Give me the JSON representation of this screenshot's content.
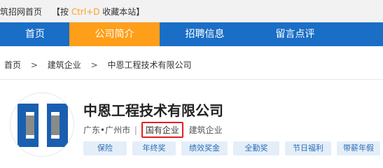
{
  "topbar": {
    "site_link": "筑招网首页",
    "bookmark_prefix": "【按 ",
    "bookmark_key": "Ctrl+D",
    "bookmark_suffix": " 收藏本站】"
  },
  "nav": {
    "items": [
      {
        "label": "首页",
        "active": false
      },
      {
        "label": "公司简介",
        "active": true
      },
      {
        "label": "招聘信息",
        "active": false
      },
      {
        "label": "留言点评",
        "active": false
      }
    ]
  },
  "breadcrumb": {
    "items": [
      "首页",
      "建筑企业",
      "中恩工程技术有限公司"
    ],
    "separator": ">"
  },
  "company": {
    "name": "中恩工程技术有限公司",
    "location": "广东•广州市",
    "separator": "|",
    "ownership": "国有企业",
    "industry": "建筑企业",
    "logo_colors": {
      "blue": "#1a5faf",
      "gray": "#8a8a8a"
    }
  },
  "benefits": [
    "保险",
    "年终奖",
    "绩效奖金",
    "全勤奖",
    "节日福利",
    "带薪年假"
  ],
  "colors": {
    "nav_bg": "#1a6ec6",
    "nav_active": "#ff9f19",
    "highlight_border": "#e02020",
    "benefit_bg": "#e4eef9",
    "benefit_text": "#2b6fb6"
  }
}
